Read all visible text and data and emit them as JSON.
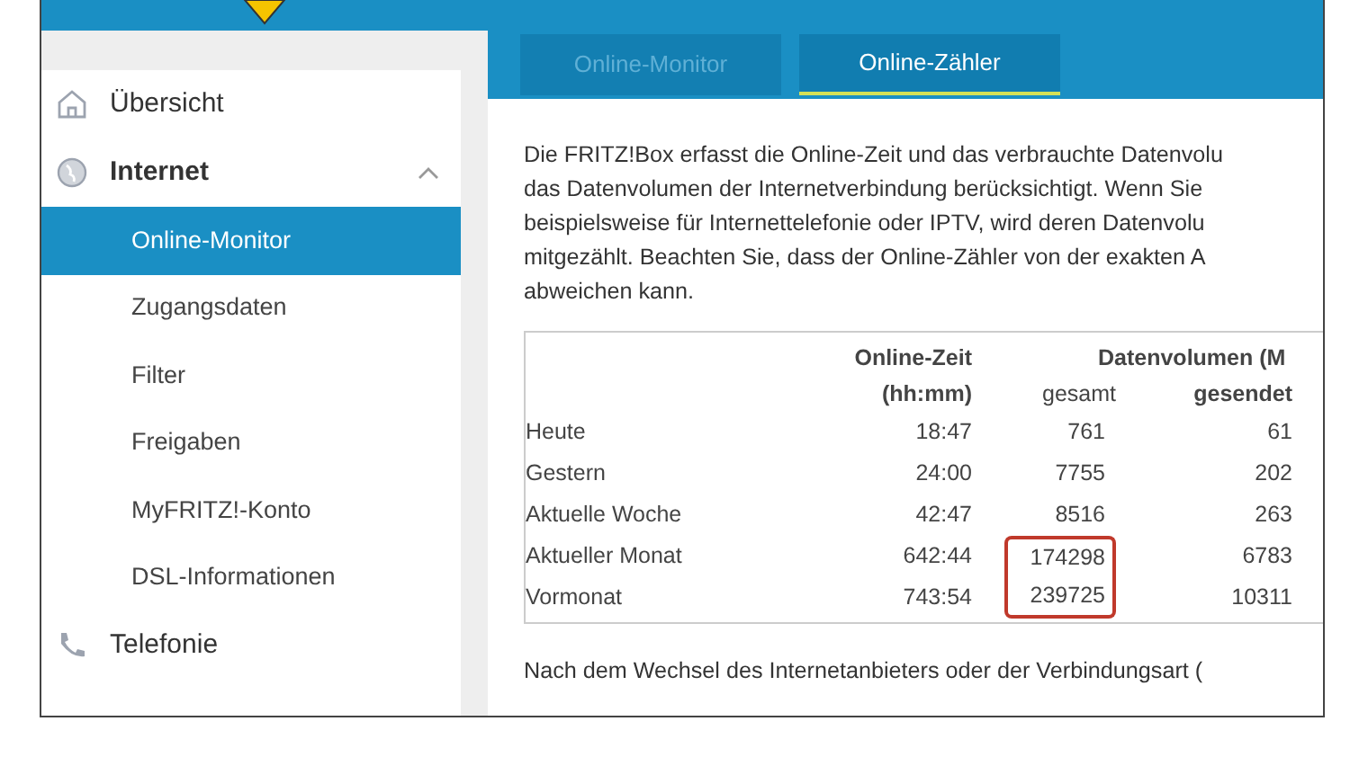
{
  "sidebar": {
    "items": [
      {
        "label": "Übersicht",
        "kind": "home",
        "selected": false,
        "expanded": false
      },
      {
        "label": "Internet",
        "kind": "globe",
        "selected": false,
        "expanded": true,
        "children": [
          {
            "label": "Online-Monitor",
            "selected": true
          },
          {
            "label": "Zugangsdaten",
            "selected": false
          },
          {
            "label": "Filter",
            "selected": false
          },
          {
            "label": "Freigaben",
            "selected": false
          },
          {
            "label": "MyFRITZ!-Konto",
            "selected": false
          },
          {
            "label": "DSL-Informationen",
            "selected": false
          }
        ]
      },
      {
        "label": "Telefonie",
        "kind": "phone",
        "selected": false,
        "expanded": false
      }
    ]
  },
  "tabs": [
    {
      "label": "Online-Monitor",
      "selected": false
    },
    {
      "label": "Online-Zähler",
      "selected": true
    }
  ],
  "intro_lines": [
    "Die FRITZ!Box erfasst die Online-Zeit und das verbrauchte Datenvolu",
    "das Datenvolumen der Internetverbindung berücksichtigt. Wenn Sie",
    "beispielsweise für Internettelefonie oder IPTV, wird deren Datenvolu",
    "mitgezählt. Beachten Sie, dass der Online-Zähler von der exakten A",
    "abweichen kann."
  ],
  "table": {
    "header_top": [
      "Online-Zeit",
      "Datenvolumen (M"
    ],
    "header_bottom": [
      "(hh:mm)",
      "gesamt",
      "gesendet"
    ],
    "rows": [
      {
        "label": "Heute",
        "online_time": "18:47",
        "total": "761",
        "sent": "61",
        "marked": false
      },
      {
        "label": "Gestern",
        "online_time": "24:00",
        "total": "7755",
        "sent": "202",
        "marked": false
      },
      {
        "label": "Aktuelle Woche",
        "online_time": "42:47",
        "total": "8516",
        "sent": "263",
        "marked": false
      },
      {
        "label": "Aktueller Monat",
        "online_time": "642:44",
        "total": "174298",
        "sent": "6783",
        "marked": true
      },
      {
        "label": "Vormonat",
        "online_time": "743:54",
        "total": "239725",
        "sent": "10311",
        "marked": true
      }
    ]
  },
  "footer_line": "Nach dem Wechsel des Internetanbieters oder der Verbindungsart ("
}
